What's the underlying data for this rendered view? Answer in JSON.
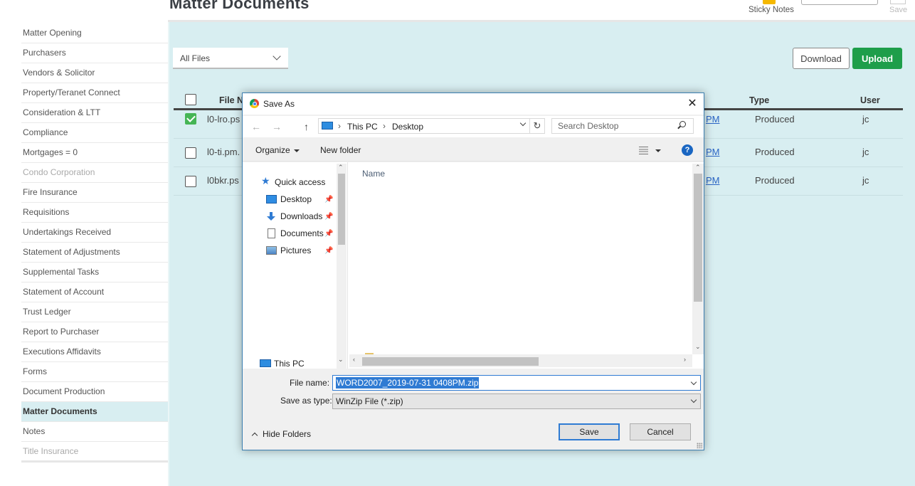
{
  "page": {
    "title": "Matter Documents",
    "sticky_notes_label": "Sticky Notes",
    "save_label": "Save"
  },
  "sidebar": {
    "items": [
      {
        "label": "Matter Opening"
      },
      {
        "label": "Purchasers"
      },
      {
        "label": "Vendors & Solicitor"
      },
      {
        "label": "Property/Teranet Connect"
      },
      {
        "label": "Consideration & LTT"
      },
      {
        "label": "Compliance"
      },
      {
        "label": "Mortgages = 0"
      },
      {
        "label": "Condo Corporation"
      },
      {
        "label": "Fire Insurance"
      },
      {
        "label": "Requisitions"
      },
      {
        "label": "Undertakings Received"
      },
      {
        "label": "Statement of Adjustments"
      },
      {
        "label": "Supplemental Tasks"
      },
      {
        "label": "Statement of Account"
      },
      {
        "label": "Trust Ledger"
      },
      {
        "label": "Report to Purchaser"
      },
      {
        "label": "Executions Affidavits"
      },
      {
        "label": "Forms"
      },
      {
        "label": "Document Production"
      },
      {
        "label": "Matter Documents"
      },
      {
        "label": "Notes"
      },
      {
        "label": "Title Insurance"
      }
    ]
  },
  "main": {
    "filter_value": "All Files",
    "download_label": "Download",
    "upload_label": "Upload",
    "table": {
      "headers": {
        "file_name": "File N",
        "type": "Type",
        "user": "User"
      },
      "rows": [
        {
          "file": "l0-lro.ps",
          "date": "PM",
          "type": "Produced",
          "user": "jc",
          "checked": true
        },
        {
          "file": "l0-ti.pm.",
          "date": "PM",
          "type": "Produced",
          "user": "jc",
          "checked": false
        },
        {
          "file": "l0bkr.ps",
          "date": "PM",
          "type": "Produced",
          "user": "jc",
          "checked": false
        }
      ]
    }
  },
  "dialog": {
    "title": "Save As",
    "close_glyph": "✕",
    "back_glyph": "←",
    "forward_glyph": "→",
    "up_glyph": "↑",
    "refresh_glyph": "↻",
    "breadcrumb": [
      "This PC",
      "Desktop"
    ],
    "breadcrumb_sep": "›",
    "search_placeholder": "Search Desktop",
    "organize_label": "Organize",
    "new_folder_label": "New folder",
    "help_glyph": "?",
    "nav_tree": {
      "quick_access": "Quick access",
      "items": [
        {
          "label": "Desktop",
          "icon": "desktop-icon"
        },
        {
          "label": "Downloads",
          "icon": "downloads-icon"
        },
        {
          "label": "Documents",
          "icon": "documents-icon"
        },
        {
          "label": "Pictures",
          "icon": "pictures-icon"
        }
      ],
      "this_pc": "This PC",
      "pin_glyph": "📌"
    },
    "files_column": "Name",
    "file_name_label": "File name:",
    "file_name_value": "WORD2007_2019-07-31 0408PM.zip",
    "save_type_label": "Save as type:",
    "save_type_value": "WinZip File (*.zip)",
    "hide_folders_label": "Hide Folders",
    "save_button": "Save",
    "cancel_button": "Cancel"
  },
  "colors": {
    "main_bg": "#d8eef1",
    "upload_green": "#1e9e4a",
    "checkbox_green": "#45b555",
    "selection_blue": "#2f7bd3"
  }
}
